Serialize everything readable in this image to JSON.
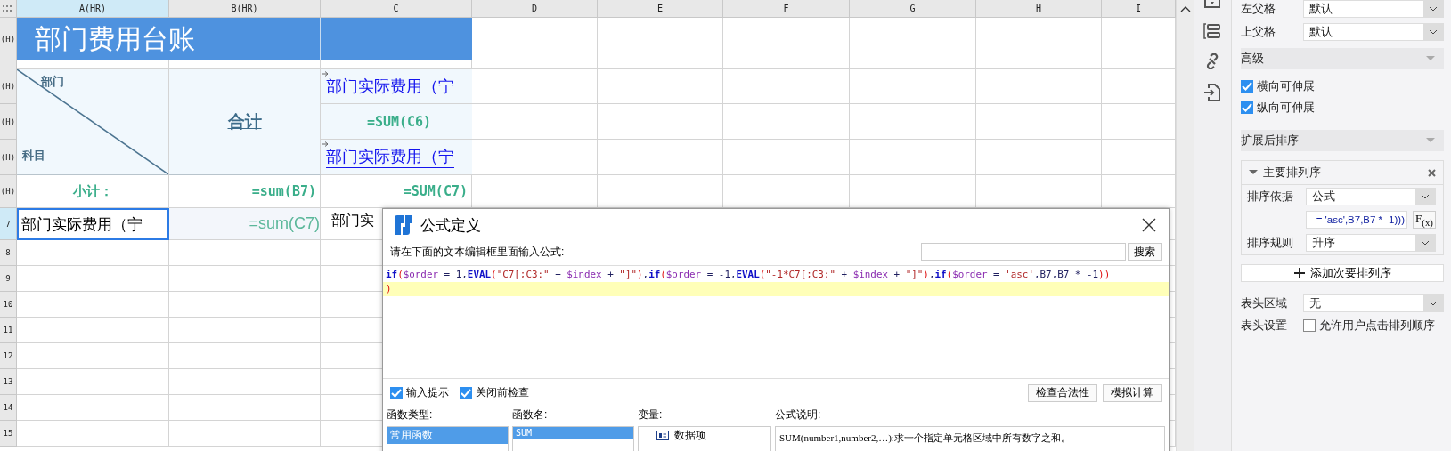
{
  "sheet": {
    "columns": [
      {
        "label": "A(HR)",
        "selected": true
      },
      {
        "label": "B(HR)",
        "selected": false
      },
      {
        "label": "C",
        "selected": false
      },
      {
        "label": "D",
        "selected": false
      },
      {
        "label": "E",
        "selected": false
      },
      {
        "label": "F",
        "selected": false
      },
      {
        "label": "G",
        "selected": false
      },
      {
        "label": "H",
        "selected": false
      },
      {
        "label": "I",
        "selected": false
      }
    ],
    "row_headers": [
      {
        "label": "(H)",
        "selected": false
      },
      {
        "label": "(H)",
        "selected": false
      },
      {
        "label": "(H)",
        "selected": false
      },
      {
        "label": "(H)",
        "selected": false
      },
      {
        "label": "(H)",
        "selected": false
      },
      {
        "label": "7",
        "selected": true
      },
      {
        "label": "8",
        "selected": false
      },
      {
        "label": "9",
        "selected": false
      },
      {
        "label": "10",
        "selected": false
      },
      {
        "label": "11",
        "selected": false
      },
      {
        "label": "12",
        "selected": false
      },
      {
        "label": "13",
        "selected": false
      },
      {
        "label": "14",
        "selected": false
      },
      {
        "label": "15",
        "selected": false
      }
    ],
    "title": "部门费用台账",
    "diagonal_header": {
      "top": "部门",
      "bottom": "科目"
    },
    "total_header": "合计",
    "c_cells": [
      {
        "kind": "link",
        "text": "部门实际费用（宁",
        "underlined": false
      },
      {
        "kind": "formula",
        "text": "=SUM(C6)"
      },
      {
        "kind": "link",
        "text": "部门实际费用（宁",
        "underlined": true
      }
    ],
    "subtotal": {
      "label": "小计：",
      "b": "=sum(B7)",
      "c": "=SUM(C7)"
    },
    "row7": {
      "a": "部门实际费用（宁",
      "a_selected": true,
      "b": "=sum(C7)",
      "c": "部门实"
    }
  },
  "dialog": {
    "title": "公式定义",
    "prompt": "请在下面的文本编辑框里面输入公式:",
    "search_button": "搜索",
    "formula_lines": [
      {
        "current": false,
        "tokens": [
          {
            "kind": "kw",
            "text": "if"
          },
          {
            "kind": "paren",
            "text": "("
          },
          {
            "kind": "var",
            "text": "$order"
          },
          {
            "kind": "text",
            "text": " = 1,"
          },
          {
            "kind": "kw",
            "text": "EVAL"
          },
          {
            "kind": "paren",
            "text": "("
          },
          {
            "kind": "str",
            "text": "\"C7[;C3:\""
          },
          {
            "kind": "text",
            "text": " + "
          },
          {
            "kind": "var",
            "text": "$index"
          },
          {
            "kind": "text",
            "text": " + "
          },
          {
            "kind": "str",
            "text": "\"]\""
          },
          {
            "kind": "paren",
            "text": ")"
          },
          {
            "kind": "text",
            "text": ","
          },
          {
            "kind": "kw",
            "text": "if"
          },
          {
            "kind": "paren",
            "text": "("
          },
          {
            "kind": "var",
            "text": "$order"
          },
          {
            "kind": "text",
            "text": " = -1,"
          },
          {
            "kind": "kw",
            "text": "EVAL"
          },
          {
            "kind": "paren",
            "text": "("
          },
          {
            "kind": "str",
            "text": "\"-1*C7[;C3:\""
          },
          {
            "kind": "text",
            "text": " + "
          },
          {
            "kind": "var",
            "text": "$index"
          },
          {
            "kind": "text",
            "text": " + "
          },
          {
            "kind": "str",
            "text": "\"]\""
          },
          {
            "kind": "paren",
            "text": ")"
          },
          {
            "kind": "text",
            "text": ","
          },
          {
            "kind": "kw",
            "text": "if"
          },
          {
            "kind": "paren",
            "text": "("
          },
          {
            "kind": "var",
            "text": "$order"
          },
          {
            "kind": "text",
            "text": " = "
          },
          {
            "kind": "str",
            "text": "'asc'"
          },
          {
            "kind": "text",
            "text": ",B7,B7 * -1"
          },
          {
            "kind": "paren",
            "text": "))"
          }
        ]
      },
      {
        "current": true,
        "tokens": [
          {
            "kind": "paren",
            "text": ")"
          }
        ]
      }
    ],
    "checkboxes": [
      {
        "label": "输入提示",
        "checked": true
      },
      {
        "label": "关闭前检查",
        "checked": true
      }
    ],
    "buttons": [
      "检查合法性",
      "模拟计算"
    ],
    "function_types": {
      "label": "函数类型:",
      "items": [
        {
          "text": "常用函数",
          "selected": true
        }
      ]
    },
    "function_names": {
      "label": "函数名:",
      "items": [
        {
          "text": "SUM",
          "selected": true
        }
      ]
    },
    "variables": {
      "label": "变量:",
      "items": [
        {
          "text": "数据项",
          "selected": false
        }
      ]
    },
    "description": {
      "label": "公式说明:",
      "text": "SUM(number1,number2,…):求一个指定单元格区域中所有数字之和。"
    }
  },
  "panel": {
    "parent_rows": [
      {
        "label": "左父格",
        "value": "默认"
      },
      {
        "label": "上父格",
        "value": "默认"
      }
    ],
    "advanced": {
      "title": "高级",
      "checkboxes": [
        {
          "label": "横向可伸展",
          "checked": true
        },
        {
          "label": "纵向可伸展",
          "checked": true
        }
      ]
    },
    "sort": {
      "title": "扩展后排序",
      "primary": {
        "title": "主要排列序",
        "basis_label": "排序依据",
        "basis": "公式",
        "formula": "= 'asc',B7,B7 * -1)))",
        "fx": "F$_{(x)}$",
        "rule_label": "排序规则",
        "rule": "升序"
      },
      "add_button": "添加次要排列序"
    },
    "header_area": {
      "label": "表头区域",
      "value": "无"
    },
    "header_setting": {
      "label": "表头设置",
      "checkbox": "允许用户点击排列顺序",
      "checked": false
    }
  }
}
